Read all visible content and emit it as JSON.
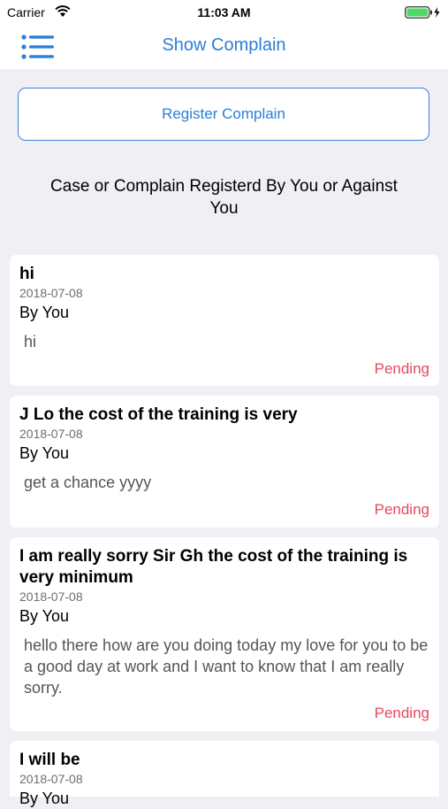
{
  "status_bar": {
    "carrier": "Carrier",
    "time": "11:03 AM"
  },
  "nav": {
    "title": "Show Complain"
  },
  "register_button": "Register Complain",
  "section_heading": "Case or Complain Registerd By You or Against You",
  "complaints": [
    {
      "title": "hi",
      "date": "2018-07-08",
      "author": "By You",
      "body": "hi",
      "status": "Pending"
    },
    {
      "title": "J Lo the cost of the training is very",
      "date": "2018-07-08",
      "author": "By You",
      "body": "get a chance yyyy",
      "status": "Pending"
    },
    {
      "title": "I am really sorry Sir Gh the cost of the training is very minimum",
      "date": "2018-07-08",
      "author": "By You",
      "body": "hello there how are you doing today my love for you to be a good day at work and I want to know that I am really sorry.",
      "status": "Pending"
    },
    {
      "title": "I will be",
      "date": "2018-07-08",
      "author": "By You",
      "body": "",
      "status": ""
    }
  ],
  "colors": {
    "accent": "#2a7fd8",
    "pending": "#e8475f",
    "battery": "#4cd964",
    "background": "#efeff4"
  },
  "icons": [
    "wifi-icon",
    "battery-icon",
    "menu-icon"
  ]
}
